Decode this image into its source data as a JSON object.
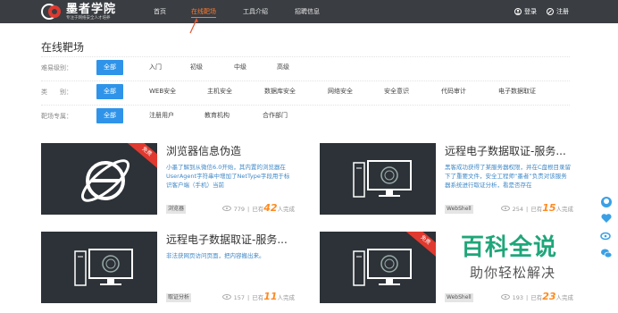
{
  "header": {
    "logo_title": "墨者学院",
    "logo_subtitle": "专注于网络安全人才培养",
    "nav": [
      "首页",
      "在线靶场",
      "工具介绍",
      "招聘信息"
    ],
    "active_nav": "在线靶场",
    "login": "登录",
    "register": "注册"
  },
  "page_title": "在线靶场",
  "filters": {
    "difficulty": {
      "label": "难易级别：",
      "options": [
        "全部",
        "入门",
        "初级",
        "中级",
        "高级"
      ]
    },
    "category": {
      "label": "类　　别：",
      "options": [
        "全部",
        "WEB安全",
        "主机安全",
        "数据库安全",
        "网络安全",
        "安全意识",
        "代码审计",
        "电子数据取证"
      ]
    },
    "special": {
      "label": "靶场专属：",
      "options": [
        "全部",
        "注册用户",
        "教育机构",
        "合作部门"
      ]
    }
  },
  "cards": [
    {
      "title": "浏览器信息伪造",
      "badge": "免费",
      "desc": "小墨了解到从微信6.0开始，其内置的浏览器在UserAgent字符串中增加了NetType字段用于标识客户端（手机）当前",
      "tag": "浏览器",
      "views": "779",
      "prefix": "已有",
      "count": "42",
      "suffix": "人完成",
      "icon": "browser-logo-icon"
    },
    {
      "title": "远程电子数据取证-服务...",
      "badge": "",
      "desc": "黑客成功获得了某服务器权限，并在C盘根目录留下了重要文件，安全工程师“墨者”负责对该服务器系统进行取证分析，看是否存在",
      "tag": "WebShell",
      "views": "254",
      "prefix": "已有",
      "count": "15",
      "suffix": "人完成",
      "icon": "computer-icon"
    },
    {
      "title": "远程电子数据取证-服务...",
      "badge": "",
      "desc": "非法获网页访问页面，把内容搬出来。",
      "tag": "取证分析",
      "views": "157",
      "prefix": "已有",
      "count": "11",
      "suffix": "人完成",
      "icon": "computer-icon"
    },
    {
      "title": "",
      "badge": "免费",
      "desc": "",
      "tag": "WebShell",
      "views": "193",
      "prefix": "已有",
      "count": "23",
      "suffix": "人完成",
      "icon": "computer-icon"
    }
  ],
  "watermark": {
    "big": "百科全说",
    "small": "助你轻松解决"
  },
  "colors": {
    "header_bg": "#3a3d42",
    "accent": "#2f94e9",
    "active_nav": "#ff7a2d",
    "badge": "#e0392f",
    "count": "#ff8a1f",
    "watermark": "#1fa67a"
  }
}
